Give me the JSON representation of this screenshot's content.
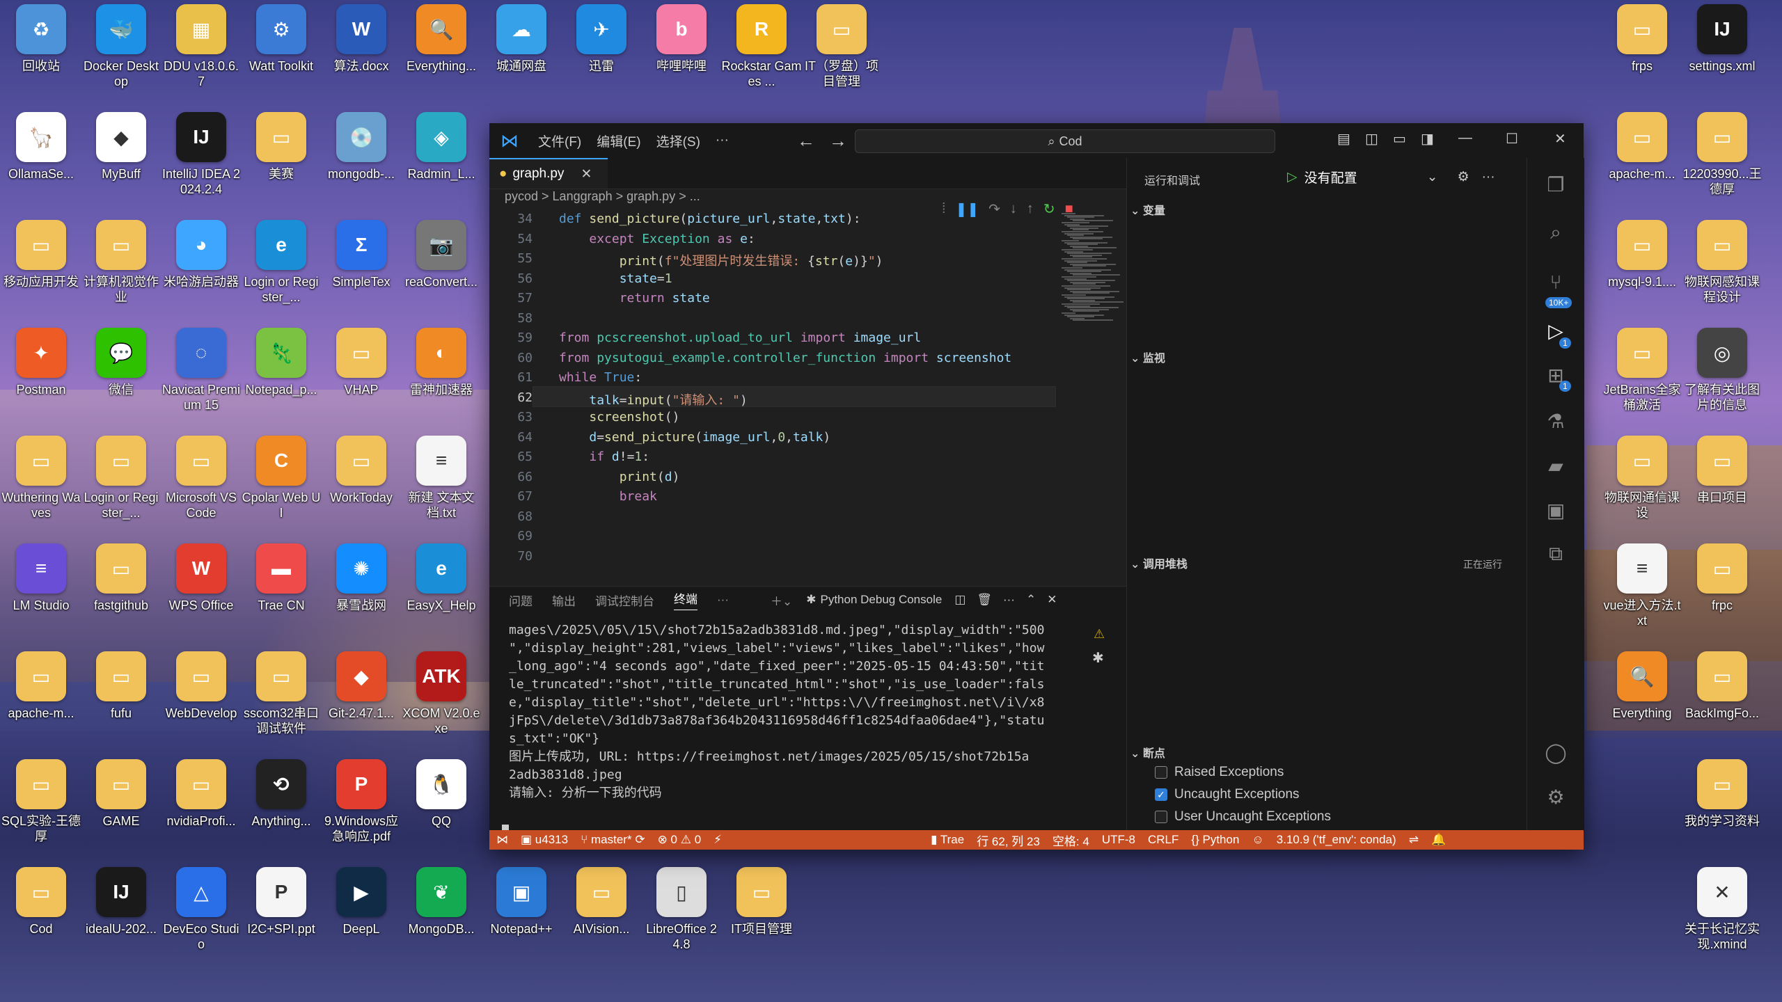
{
  "desktop": {
    "left_icons": [
      {
        "label": "回收站",
        "glyph": "♻",
        "color": "#4c93d9"
      },
      {
        "label": "Docker Desktop",
        "glyph": "🐳",
        "color": "#1d91e6"
      },
      {
        "label": "DDU v18.0.6.7",
        "glyph": "▦",
        "color": "#e8c04a"
      },
      {
        "label": "Watt Toolkit",
        "glyph": "⚙",
        "color": "#3b7bd6"
      },
      {
        "label": "算法.docx",
        "glyph": "W",
        "color": "#2b5bb8"
      },
      {
        "label": "Everything...",
        "glyph": "🔍",
        "color": "#f08a24"
      },
      {
        "label": "城通网盘",
        "glyph": "☁",
        "color": "#36a1e8"
      },
      {
        "label": "迅雷",
        "glyph": "✈",
        "color": "#1f8ae0"
      },
      {
        "label": "哔哩哔哩",
        "glyph": "b",
        "color": "#f47ca6"
      },
      {
        "label": "Rockstar Games ...",
        "glyph": "R",
        "color": "#f3b61f"
      },
      {
        "label": "IT（罗盘）项目管理",
        "glyph": "▭",
        "color": "#f2c25a"
      },
      {
        "label": "OllamaSe...",
        "glyph": "🦙",
        "color": "#ffffff"
      },
      {
        "label": "MyBuff",
        "glyph": "◆",
        "color": "#ffffff"
      },
      {
        "label": "IntelliJ IDEA 2024.2.4",
        "glyph": "IJ",
        "color": "#1a1a1a"
      },
      {
        "label": "美赛",
        "glyph": "▭",
        "color": "#f2c25a"
      },
      {
        "label": "mongodb-...",
        "glyph": "💿",
        "color": "#6aa0d0"
      },
      {
        "label": "Radmin_L...",
        "glyph": "◈",
        "color": "#2aa9c5"
      },
      {
        "label": "移动应用开发",
        "glyph": "▭",
        "color": "#f2c25a"
      },
      {
        "label": "计算机视觉作业",
        "glyph": "▭",
        "color": "#f2c25a"
      },
      {
        "label": "米哈游启动器",
        "glyph": "◕",
        "color": "#3ea6ff"
      },
      {
        "label": "Login or Register_...",
        "glyph": "e",
        "color": "#1a8fd8"
      },
      {
        "label": "SimpleTex",
        "glyph": "Σ",
        "color": "#2a6fe8"
      },
      {
        "label": "reaConvert...",
        "glyph": "📷",
        "color": "#777777"
      },
      {
        "label": "Postman",
        "glyph": "✦",
        "color": "#ef5b25"
      },
      {
        "label": "微信",
        "glyph": "💬",
        "color": "#2dc100"
      },
      {
        "label": "Navicat Premium 15",
        "glyph": "◌",
        "color": "#3a6bd4"
      },
      {
        "label": "Notepad_p...",
        "glyph": "🦎",
        "color": "#7cc242"
      },
      {
        "label": "VHAP",
        "glyph": "▭",
        "color": "#f2c25a"
      },
      {
        "label": "雷神加速器",
        "glyph": "◐",
        "color": "#f08a24"
      },
      {
        "label": "Wuthering Waves",
        "glyph": "▭",
        "color": "#f2c25a"
      },
      {
        "label": "Login or Register_...",
        "glyph": "▭",
        "color": "#f2c25a"
      },
      {
        "label": "Microsoft VS Code",
        "glyph": "▭",
        "color": "#f2c25a"
      },
      {
        "label": "Cpolar Web UI",
        "glyph": "C",
        "color": "#f08a24"
      },
      {
        "label": "WorkToday",
        "glyph": "▭",
        "color": "#f2c25a"
      },
      {
        "label": "新建 文本文档.txt",
        "glyph": "≡",
        "color": "#f5f5f5"
      },
      {
        "label": "LM Studio",
        "glyph": "≡",
        "color": "#6a4fd6"
      },
      {
        "label": "fastgithub",
        "glyph": "▭",
        "color": "#f2c25a"
      },
      {
        "label": "WPS Office",
        "glyph": "W",
        "color": "#e23d2e"
      },
      {
        "label": "Trae CN",
        "glyph": "▬",
        "color": "#ef4b4b"
      },
      {
        "label": "暴雪战网",
        "glyph": "✺",
        "color": "#148eff"
      },
      {
        "label": "EasyX_Help",
        "glyph": "e",
        "color": "#1a8fd8"
      },
      {
        "label": "apache-m...",
        "glyph": "▭",
        "color": "#f2c25a"
      },
      {
        "label": "fufu",
        "glyph": "▭",
        "color": "#f2c25a"
      },
      {
        "label": "WebDevelop",
        "glyph": "▭",
        "color": "#f2c25a"
      },
      {
        "label": "sscom32串口调试软件",
        "glyph": "▭",
        "color": "#f2c25a"
      },
      {
        "label": "Git-2.47.1...",
        "glyph": "◆",
        "color": "#e34c26"
      },
      {
        "label": "XCOM V2.0.exe",
        "glyph": "ATK",
        "color": "#b31b1b"
      },
      {
        "label": "SQL实验-王德厚",
        "glyph": "▭",
        "color": "#f2c25a"
      },
      {
        "label": "GAME",
        "glyph": "▭",
        "color": "#f2c25a"
      },
      {
        "label": "nvidiaProfi...",
        "glyph": "▭",
        "color": "#f2c25a"
      },
      {
        "label": "Anything...",
        "glyph": "⟲",
        "color": "#222222"
      },
      {
        "label": "9.Windows应急响应.pdf",
        "glyph": "P",
        "color": "#e23d2e"
      },
      {
        "label": "QQ",
        "glyph": "🐧",
        "color": "#ffffff"
      },
      {
        "label": "Cod",
        "glyph": "▭",
        "color": "#f2c25a"
      },
      {
        "label": "idealU-202...",
        "glyph": "IJ",
        "color": "#1a1a1a"
      },
      {
        "label": "DevEco Studio",
        "glyph": "△",
        "color": "#2a6fe8"
      },
      {
        "label": "I2C+SPI.ppt",
        "glyph": "P",
        "color": "#f5f5f5"
      },
      {
        "label": "DeepL",
        "glyph": "▶",
        "color": "#0f2b46"
      },
      {
        "label": "MongoDB...",
        "glyph": "❦",
        "color": "#13aa52"
      },
      {
        "label": "Notepad++",
        "glyph": "▣",
        "color": "#2b7bd6"
      },
      {
        "label": "AIVision...",
        "glyph": "▭",
        "color": "#f2c25a"
      },
      {
        "label": "LibreOffice 24.8",
        "glyph": "▯",
        "color": "#dddddd"
      },
      {
        "label": "IT项目管理",
        "glyph": "▭",
        "color": "#f2c25a"
      }
    ],
    "right_icons": [
      {
        "label": "frps",
        "glyph": "▭",
        "color": "#f2c25a"
      },
      {
        "label": "settings.xml",
        "glyph": "IJ",
        "color": "#1a1a1a"
      },
      {
        "label": "apache-m...",
        "glyph": "▭",
        "color": "#f2c25a"
      },
      {
        "label": "12203990...王德厚",
        "glyph": "▭",
        "color": "#f2c25a"
      },
      {
        "label": "mysql-9.1....",
        "glyph": "▭",
        "color": "#f2c25a"
      },
      {
        "label": "物联网感知课程设计",
        "glyph": "▭",
        "color": "#f2c25a"
      },
      {
        "label": "JetBrains全家桶激活",
        "glyph": "▭",
        "color": "#f2c25a"
      },
      {
        "label": "了解有关此图片的信息",
        "glyph": "◎",
        "color": "#444444"
      },
      {
        "label": "物联网通信课设",
        "glyph": "▭",
        "color": "#f2c25a"
      },
      {
        "label": "串口项目",
        "glyph": "▭",
        "color": "#f2c25a"
      },
      {
        "label": "vue进入方法.txt",
        "glyph": "≡",
        "color": "#f5f5f5"
      },
      {
        "label": "frpc",
        "glyph": "▭",
        "color": "#f2c25a"
      },
      {
        "label": "Everything",
        "glyph": "🔍",
        "color": "#f08a24"
      },
      {
        "label": "BackImgFo...",
        "glyph": "▭",
        "color": "#f2c25a"
      },
      {
        "label": "我的学习资料",
        "glyph": "▭",
        "color": "#f2c25a"
      },
      {
        "label": "关于长记忆实现.xmind",
        "glyph": "✕",
        "color": "#f5f5f5"
      }
    ]
  },
  "vscode": {
    "menu": [
      "文件(F)",
      "编辑(E)",
      "选择(S)",
      "···"
    ],
    "search": "Cod",
    "tab_name": "graph.py",
    "breadcrumb": "pycod > Langgraph > graph.py > ...",
    "code_lines": [
      {
        "n": "34",
        "html": "<span class='kw2'>def</span> <span class='fn'>send_picture</span>(<span class='var'>picture_url</span>,<span class='var'>state</span>,<span class='var'>txt</span>):"
      },
      {
        "n": "54",
        "html": "    <span class='kw'>except</span> <span class='cls'>Exception</span> <span class='kw'>as</span> <span class='var'>e</span>:"
      },
      {
        "n": "55",
        "html": "        <span class='fn'>print</span>(<span class='str'>f\"处理图片时发生错误: </span>{<span class='fn'>str</span>(<span class='var'>e</span>)}<span class='str'>\"</span>)"
      },
      {
        "n": "56",
        "html": "        <span class='var'>state</span>=<span class='num'>1</span>"
      },
      {
        "n": "57",
        "html": "        <span class='kw'>return</span> <span class='var'>state</span>"
      },
      {
        "n": "58",
        "html": ""
      },
      {
        "n": "59",
        "html": "<span class='kw'>from</span> <span class='cls'>pcscreenshot.upload_to_url</span> <span class='kw'>import</span> <span class='var'>image_url</span>"
      },
      {
        "n": "60",
        "html": "<span class='kw'>from</span> <span class='cls'>pysutogui_example.controller_function</span> <span class='kw'>import</span> <span class='var'>screenshot</span>"
      },
      {
        "n": "61",
        "html": "<span class='kw'>while</span> <span class='kw2'>True</span>:"
      },
      {
        "n": "62",
        "html": "    <span class='var'>talk</span>=<span class='fn'>input</span>(<span class='str'>\"请输入: \"</span>)"
      },
      {
        "n": "63",
        "html": "    <span class='fn'>screenshot</span>()"
      },
      {
        "n": "64",
        "html": "    <span class='var'>d</span>=<span class='fn'>send_picture</span>(<span class='var'>image_url</span>,<span class='num'>0</span>,<span class='var'>talk</span>)"
      },
      {
        "n": "65",
        "html": "    <span class='kw'>if</span> <span class='var'>d</span>!=<span class='num'>1</span>:"
      },
      {
        "n": "66",
        "html": "        <span class='fn'>print</span>(<span class='var'>d</span>)"
      },
      {
        "n": "67",
        "html": "        <span class='kw'>break</span>"
      },
      {
        "n": "68",
        "html": ""
      },
      {
        "n": "69",
        "html": ""
      },
      {
        "n": "70",
        "html": ""
      }
    ],
    "panel_tabs": [
      "问题",
      "输出",
      "调试控制台",
      "终端",
      "···"
    ],
    "panel_active": "终端",
    "terminal_name": "Python Debug Console",
    "terminal_text": "mages\\/2025\\/05\\/15\\/shot72b15a2adb3831d8.md.jpeg\",\"display_width\":\"500\n\",\"display_height\":281,\"views_label\":\"views\",\"likes_label\":\"likes\",\"how\n_long_ago\":\"4 seconds ago\",\"date_fixed_peer\":\"2025-05-15 04:43:50\",\"tit\nle_truncated\":\"shot\",\"title_truncated_html\":\"shot\",\"is_use_loader\":fals\ne,\"display_title\":\"shot\",\"delete_url\":\"https:\\/\\/freeimghost.net\\/i\\/x8\njFpS\\/delete\\/3d1db73a878af364b2043116958d46ff1c8254dfaa06dae4\"},\"statu\ns_txt\":\"OK\"}\n图片上传成功, URL: https://freeimghost.net/images/2025/05/15/shot72b15a\n2adb3831d8.jpeg\n请输入: 分析一下我的代码",
    "debug": {
      "title": "运行和调试",
      "config": "没有配置",
      "sections": [
        "变量",
        "监视",
        "调用堆栈",
        "断点"
      ],
      "callstack_status": "正在运行",
      "breakpoints": [
        {
          "label": "Raised Exceptions",
          "checked": false
        },
        {
          "label": "Uncaught Exceptions",
          "checked": true
        },
        {
          "label": "User Uncaught Exceptions",
          "checked": false
        }
      ]
    },
    "activity_badges": {
      "scm": "10K+",
      "debug": "1",
      "ext": "1"
    },
    "status": {
      "user": "u4313",
      "branch": "master*",
      "errors": "0",
      "warnings": "0",
      "trae": "Trae",
      "position": "行 62, 列 23",
      "indent": "空格: 4",
      "encoding": "UTF-8",
      "eol": "CRLF",
      "lang": "Python",
      "interpreter": "3.10.9 ('tf_env': conda)"
    }
  }
}
